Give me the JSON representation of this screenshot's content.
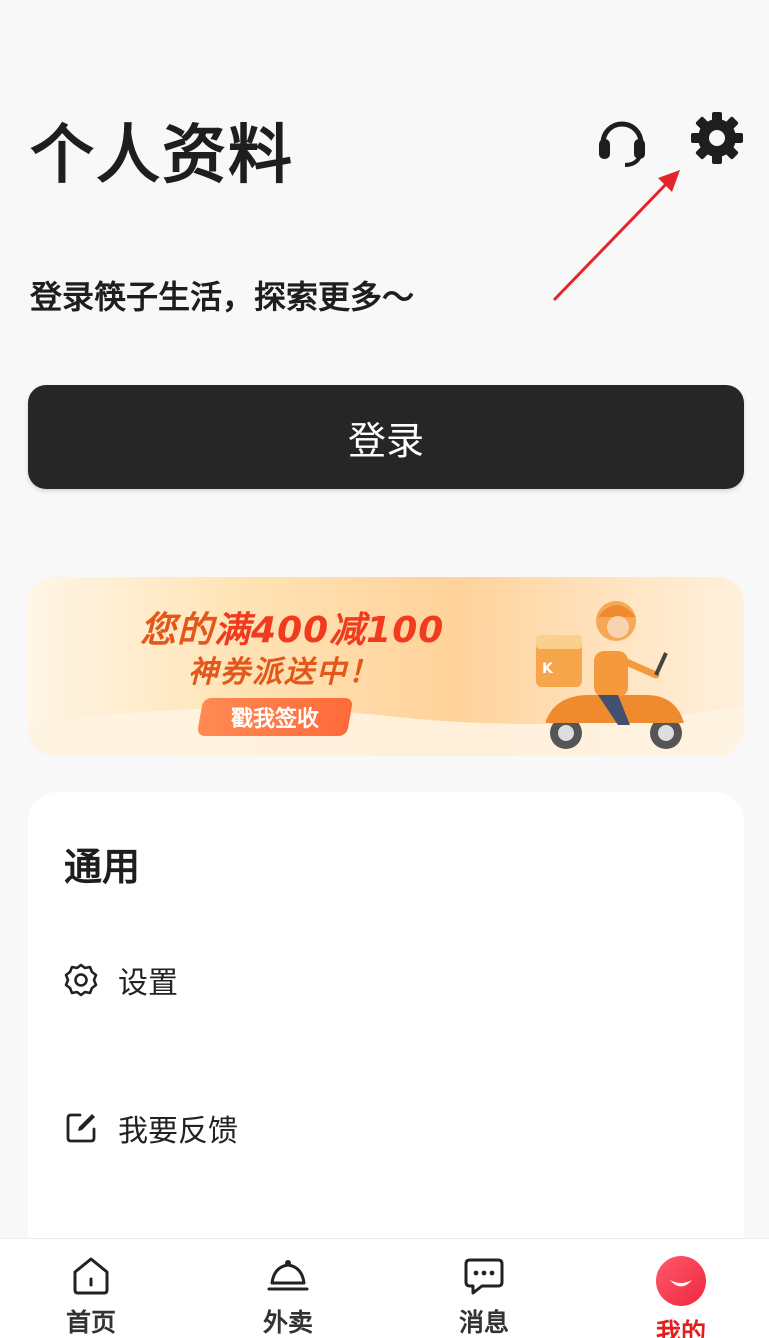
{
  "header": {
    "title": "个人资料",
    "icons": {
      "support": "headset-icon",
      "settings": "gear-icon"
    }
  },
  "subtitle": "登录筷子生活，探索更多～",
  "login_button": {
    "label": "登录"
  },
  "promo": {
    "line1_prefix": "您的",
    "line1_highlight": "满400减100",
    "line2": "神券派送中！",
    "cta": "戳我签收"
  },
  "general": {
    "title": "通用",
    "items": [
      {
        "label": "设置",
        "icon": "gear-outline-icon"
      },
      {
        "label": "我要反馈",
        "icon": "edit-square-icon"
      }
    ]
  },
  "bottom_nav": {
    "items": [
      {
        "label": "首页",
        "icon": "home-icon"
      },
      {
        "label": "外卖",
        "icon": "cloche-icon"
      },
      {
        "label": "消息",
        "icon": "chat-bubble-icon"
      },
      {
        "label": "我的",
        "icon": "smile-avatar-icon",
        "active": true
      }
    ]
  },
  "colors": {
    "accent_red": "#e0201c",
    "button_dark": "#262626",
    "promo_orange": "#e4571a"
  }
}
